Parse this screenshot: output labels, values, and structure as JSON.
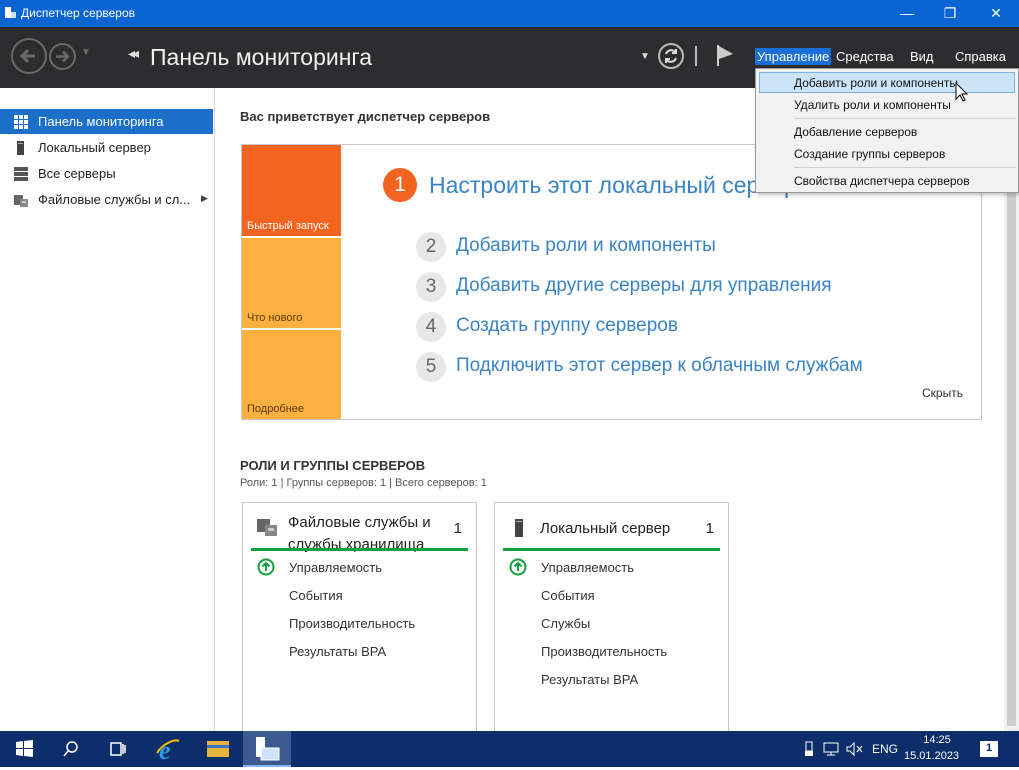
{
  "window": {
    "title": "Диспетчер серверов",
    "minimize": "—",
    "maximize": "❐",
    "close": "✕"
  },
  "header": {
    "title": "Панель мониторинга",
    "menus": [
      "Управление",
      "Средства",
      "Вид",
      "Справка"
    ]
  },
  "sidebar": {
    "items": [
      {
        "label": "Панель мониторинга",
        "icon": "dashboard-icon",
        "active": true
      },
      {
        "label": "Локальный сервер",
        "icon": "server-icon"
      },
      {
        "label": "Все серверы",
        "icon": "servers-icon"
      },
      {
        "label": "Файловые службы и сл...",
        "icon": "file-services-icon"
      }
    ]
  },
  "welcome": {
    "heading": "Вас приветствует диспетчер серверов"
  },
  "quickstart": {
    "tiles": [
      "Быстрый запуск",
      "Что нового",
      "Подробнее"
    ],
    "steps": [
      {
        "num": "1",
        "label": "Настроить этот локальный сервер"
      },
      {
        "num": "2",
        "label": "Добавить роли и компоненты"
      },
      {
        "num": "3",
        "label": "Добавить другие серверы для управления"
      },
      {
        "num": "4",
        "label": "Создать группу серверов"
      },
      {
        "num": "5",
        "label": "Подключить этот сервер к облачным службам"
      }
    ],
    "hide": "Скрыть"
  },
  "roles": {
    "title": "РОЛИ И ГРУППЫ СЕРВЕРОВ",
    "subtitle": "Роли: 1 | Группы серверов: 1 | Всего серверов: 1",
    "cards": [
      {
        "title_line1": "Файловые службы и",
        "title_line2": "службы хранилища",
        "count": "1",
        "rows": [
          "Управляемость",
          "События",
          "Производительность",
          "Результаты BPA"
        ]
      },
      {
        "title_line1": "Локальный сервер",
        "count": "1",
        "rows": [
          "Управляемость",
          "События",
          "Службы",
          "Производительность",
          "Результаты BPA"
        ]
      }
    ]
  },
  "dropdown": {
    "items": [
      "Добавить роли и компоненты",
      "Удалить роли и компоненты",
      "Добавление серверов",
      "Создание группы серверов",
      "Свойства диспетчера серверов"
    ]
  },
  "taskbar": {
    "lang": "ENG",
    "time": "14:25",
    "date": "15.01.2023",
    "notifications": "1"
  },
  "colors": {
    "accent": "#1c6fc8",
    "orange": "#f2641f",
    "amber": "#fbb040",
    "green": "#11a33b",
    "header": "#2d2d30",
    "taskbar": "#0d2d6b"
  }
}
